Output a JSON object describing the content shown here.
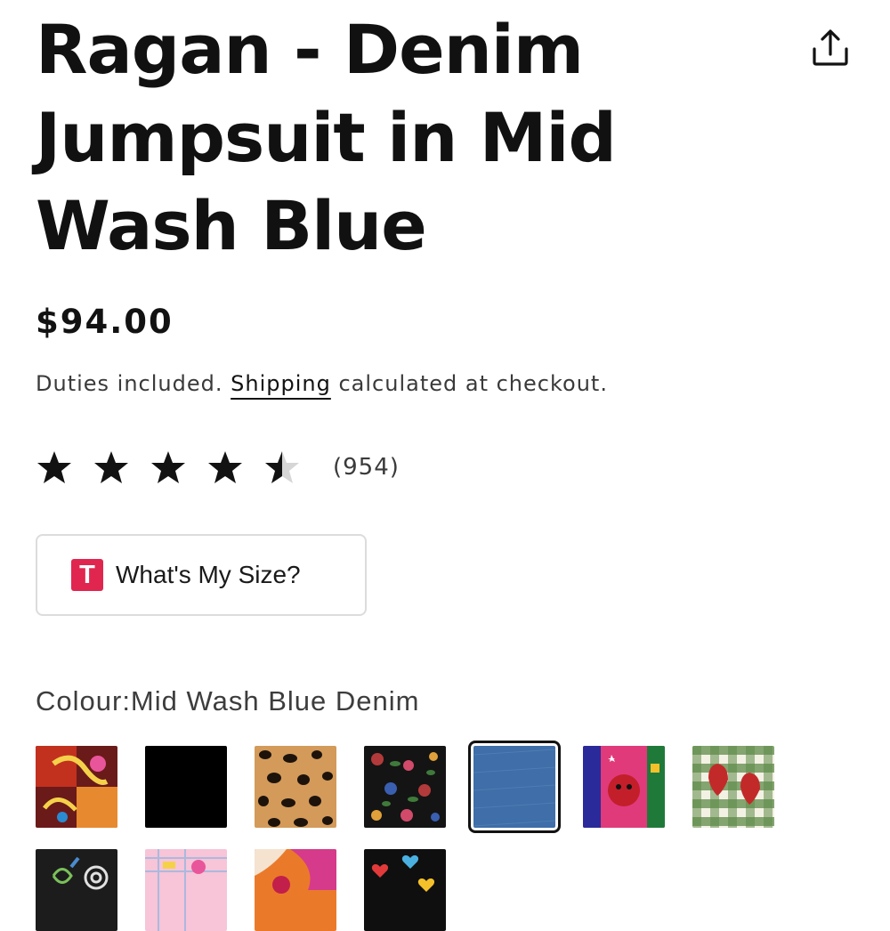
{
  "product": {
    "title": "Ragan - Denim Jumpsuit in Mid Wash Blue",
    "price": "$94.00",
    "tax_note_prefix": "Duties included.",
    "tax_note_link": "Shipping",
    "tax_note_suffix": "calculated at checkout."
  },
  "rating": {
    "value": 4.5,
    "max": 5,
    "count_label": "(954)"
  },
  "size_button": {
    "logo_letter": "T",
    "label": "What's My Size?"
  },
  "colour": {
    "label": "Colour:Mid Wash Blue Denim",
    "swatches": [
      {
        "name": "colorful-abstract-print"
      },
      {
        "name": "black"
      },
      {
        "name": "leopard-print"
      },
      {
        "name": "dark-floral-print"
      },
      {
        "name": "mid-wash-blue-denim",
        "selected": true
      },
      {
        "name": "pink-face-print"
      },
      {
        "name": "green-gingham-strawberry"
      },
      {
        "name": "dark-swirl-print"
      },
      {
        "name": "pink-pastel-print"
      },
      {
        "name": "orange-pink-abstract"
      },
      {
        "name": "black-hearts-print"
      }
    ]
  },
  "icons": {
    "share": "share-icon",
    "star": "star-icon"
  },
  "colors": {
    "text": "#121212",
    "muted": "#3a3a3a",
    "border": "#dcdcdc",
    "logo_red": "#e0264f",
    "denim": "#3f6ea8"
  }
}
